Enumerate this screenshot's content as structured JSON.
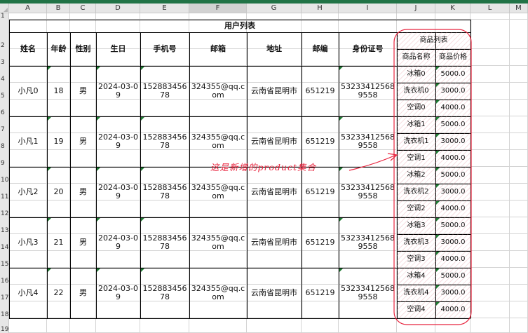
{
  "columns": [
    "A",
    "B",
    "C",
    "D",
    "E",
    "F",
    "G",
    "H",
    "I",
    "J",
    "K",
    "L",
    "M"
  ],
  "rows": [
    "1",
    "2",
    "3",
    "4",
    "5",
    "6",
    "7",
    "8",
    "9",
    "10",
    "11",
    "12",
    "13",
    "14",
    "15",
    "16",
    "17",
    "18",
    "19"
  ],
  "title": "用户列表",
  "headers": {
    "name": "姓名",
    "age": "年龄",
    "gender": "性别",
    "birthday": "生日",
    "phone": "手机号",
    "email": "邮箱",
    "address": "地址",
    "zip": "邮编",
    "id_number": "身份证号",
    "products_group": "商品列表",
    "product_name": "商品名称",
    "product_price": "商品价格"
  },
  "users": [
    {
      "name": "小凡0",
      "age": "18",
      "gender": "男",
      "birthday": "2024-03-09",
      "phone": "15288345678",
      "email": "324355@qq.com",
      "address": "云南省昆明市",
      "zip": "651219",
      "id_number": "532334125689558",
      "products": [
        {
          "name": "冰箱0",
          "price": "5000.0"
        },
        {
          "name": "洗衣机0",
          "price": "3000.0"
        },
        {
          "name": "空调0",
          "price": "4000.0"
        }
      ]
    },
    {
      "name": "小凡1",
      "age": "19",
      "gender": "男",
      "birthday": "2024-03-09",
      "phone": "15288345678",
      "email": "324355@qq.com",
      "address": "云南省昆明市",
      "zip": "651219",
      "id_number": "532334125689558",
      "products": [
        {
          "name": "冰箱1",
          "price": "5000.0"
        },
        {
          "name": "洗衣机1",
          "price": "3000.0"
        },
        {
          "name": "空调1",
          "price": "4000.0"
        }
      ]
    },
    {
      "name": "小凡2",
      "age": "20",
      "gender": "男",
      "birthday": "2024-03-09",
      "phone": "15288345678",
      "email": "324355@qq.com",
      "address": "云南省昆明市",
      "zip": "651219",
      "id_number": "532334125689558",
      "products": [
        {
          "name": "冰箱2",
          "price": "5000.0"
        },
        {
          "name": "洗衣机2",
          "price": "3000.0"
        },
        {
          "name": "空调2",
          "price": "4000.0"
        }
      ]
    },
    {
      "name": "小凡3",
      "age": "21",
      "gender": "男",
      "birthday": "2024-03-09",
      "phone": "15288345678",
      "email": "324355@qq.com",
      "address": "云南省昆明市",
      "zip": "651219",
      "id_number": "532334125689558",
      "products": [
        {
          "name": "冰箱3",
          "price": "5000.0"
        },
        {
          "name": "洗衣机3",
          "price": "3000.0"
        },
        {
          "name": "空调3",
          "price": "4000.0"
        }
      ]
    },
    {
      "name": "小凡4",
      "age": "22",
      "gender": "男",
      "birthday": "2024-03-09",
      "phone": "15288345678",
      "email": "324355@qq.com",
      "address": "云南省昆明市",
      "zip": "651219",
      "id_number": "532334125689558",
      "products": [
        {
          "name": "冰箱4",
          "price": "5000.0"
        },
        {
          "name": "洗衣机4",
          "price": "3000.0"
        },
        {
          "name": "空调4",
          "price": "4000.0"
        }
      ]
    }
  ],
  "annotation": "这是新增的product集合",
  "colors": {
    "excel_green": "#217346",
    "annotation_red": "#e8233d",
    "hatch_pink": "#e896a0"
  }
}
